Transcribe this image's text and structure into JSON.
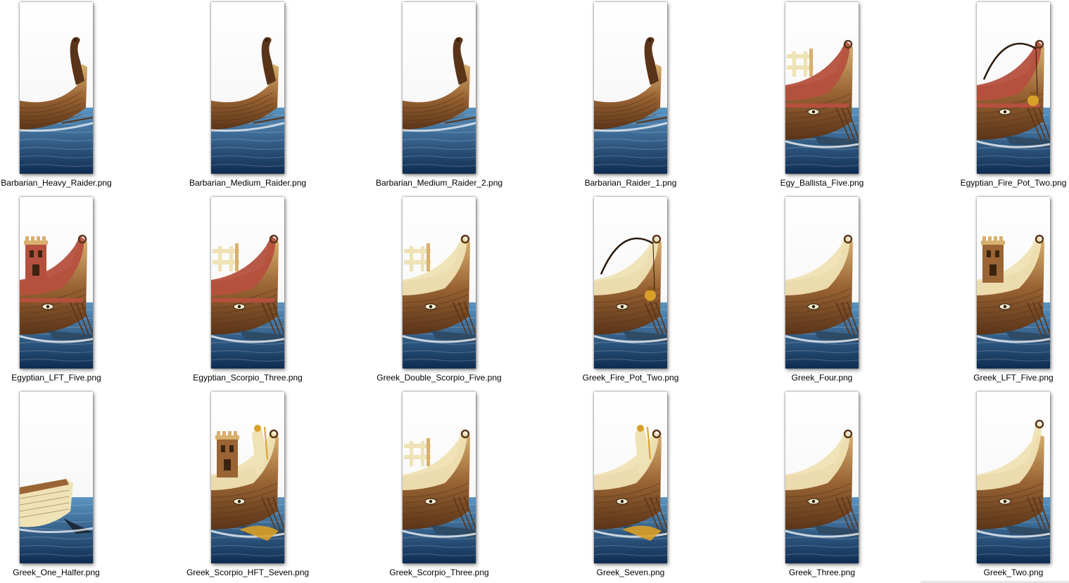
{
  "colors": {
    "sea_top": "#5b95c2",
    "sea_bottom": "#0f2c52",
    "wood_dark": "#5a3418",
    "wood_mid": "#9a6434",
    "wood_light": "#d8b070",
    "cream": "#efe2b4",
    "red_trim": "#b5503e",
    "gold": "#d9a028"
  },
  "files": [
    {
      "name": "Barbarian_Heavy_Raider.png",
      "ship": "barbarian-raider"
    },
    {
      "name": "Barbarian_Medium_Raider.png",
      "ship": "barbarian-raider"
    },
    {
      "name": "Barbarian_Medium_Raider_2.png",
      "ship": "barbarian-raider"
    },
    {
      "name": "Barbarian_Raider_1.png",
      "ship": "barbarian-raider"
    },
    {
      "name": "Egy_Ballista_Five.png",
      "ship": "egyptian-ballista"
    },
    {
      "name": "Egyptian_Fire_Pot_Two.png",
      "ship": "egyptian-firepot"
    },
    {
      "name": "Egyptian_LFT_Five.png",
      "ship": "egyptian-tower"
    },
    {
      "name": "Egyptian_Scorpio_Three.png",
      "ship": "egyptian-scorpio"
    },
    {
      "name": "Greek_Double_Scorpio_Five.png",
      "ship": "greek-scorpio"
    },
    {
      "name": "Greek_Fire_Pot_Two.png",
      "ship": "greek-firepot"
    },
    {
      "name": "Greek_Four.png",
      "ship": "greek-plain"
    },
    {
      "name": "Greek_LFT_Five.png",
      "ship": "greek-tower"
    },
    {
      "name": "Greek_One_Halfer.png",
      "ship": "greek-halfer"
    },
    {
      "name": "Greek_Scorpio_HFT_Seven.png",
      "ship": "greek-statue-tower"
    },
    {
      "name": "Greek_Scorpio_Three.png",
      "ship": "greek-scorpio"
    },
    {
      "name": "Greek_Seven.png",
      "ship": "greek-statue"
    },
    {
      "name": "Greek_Three.png",
      "ship": "greek-plain"
    },
    {
      "name": "Greek_Two.png",
      "ship": "greek-plain-tall"
    }
  ]
}
